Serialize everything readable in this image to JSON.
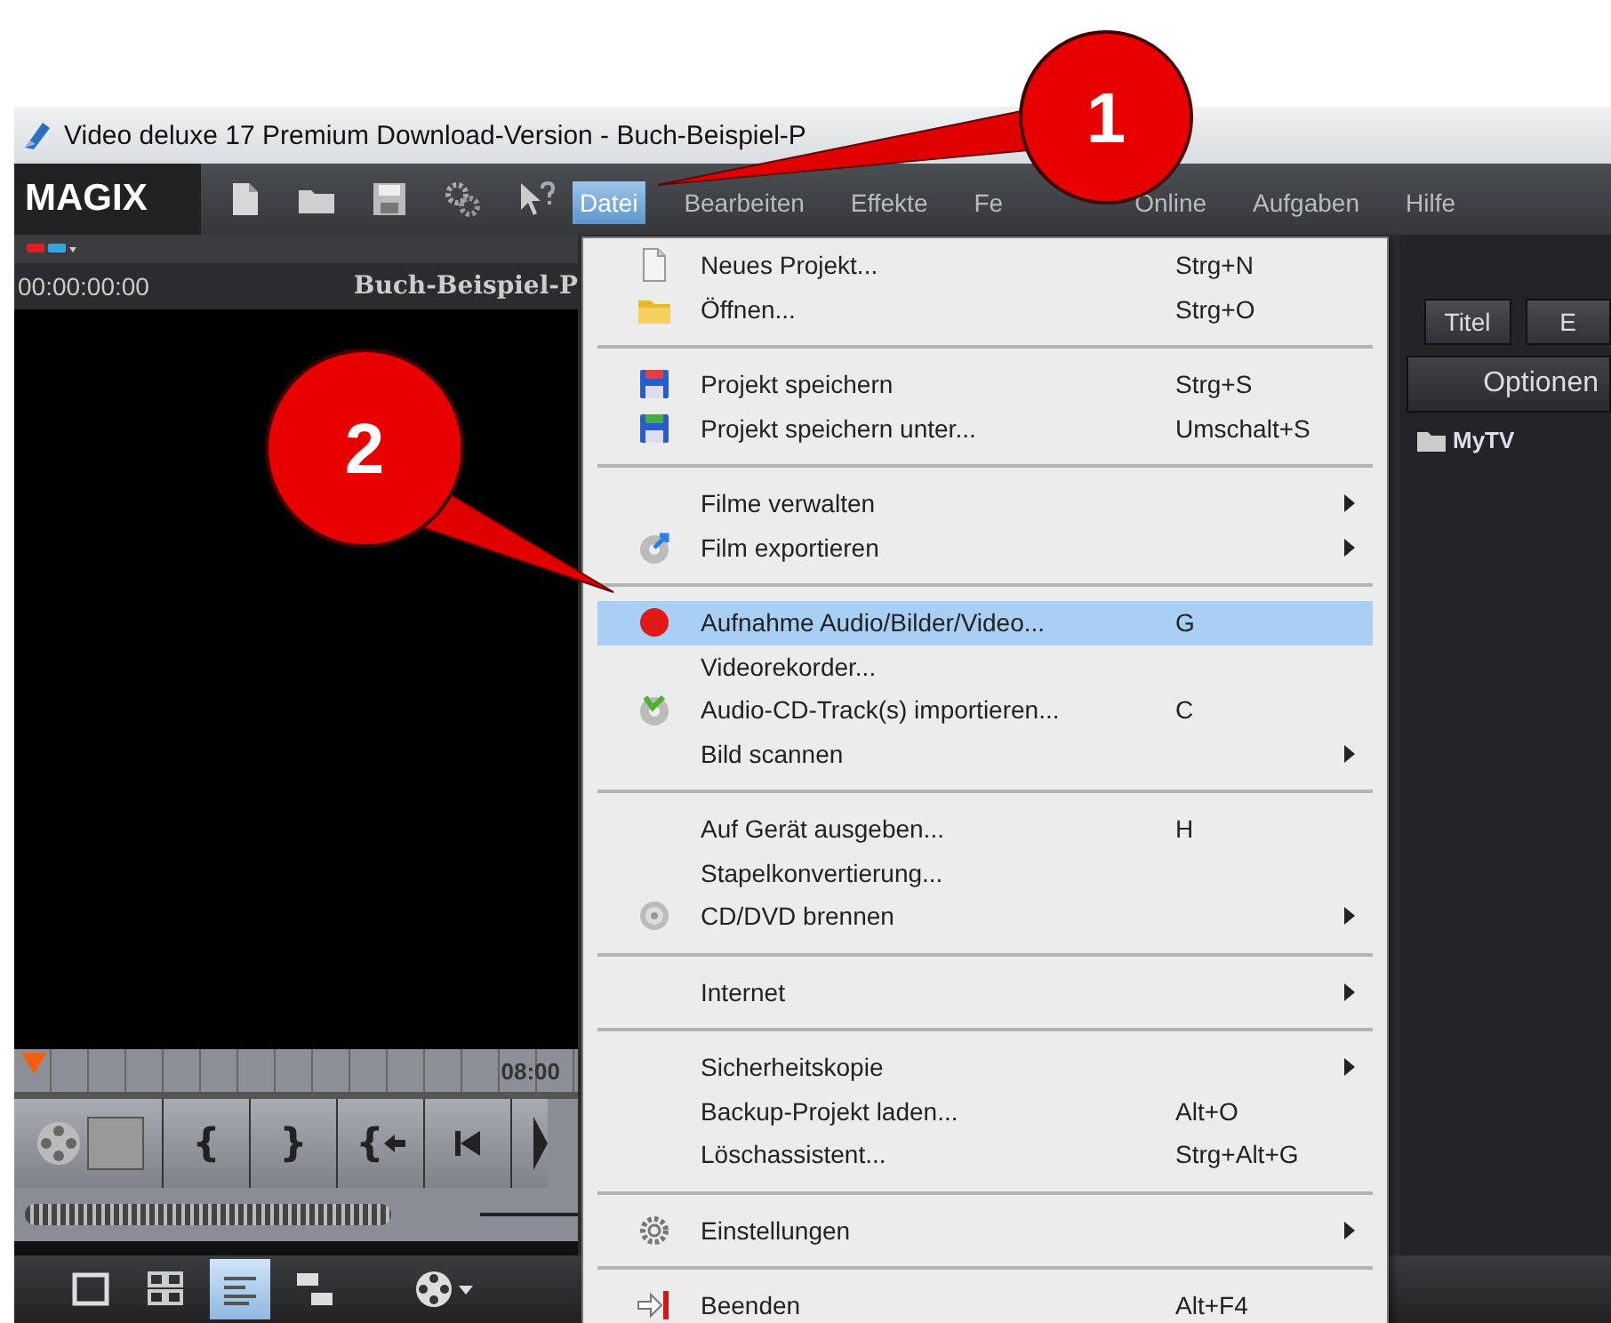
{
  "window": {
    "title": "Video deluxe 17 Premium Download-Version - Buch-Beispiel-P"
  },
  "logo": "MAGIX",
  "menubar": [
    {
      "label": "Datei",
      "selected": true
    },
    {
      "label": "Bearbeiten",
      "selected": false
    },
    {
      "label": "Effekte",
      "selected": false
    },
    {
      "label": "Fe",
      "selected": false
    },
    {
      "label": "Online",
      "selected": false
    },
    {
      "label": "Aufgaben",
      "selected": false
    },
    {
      "label": "Hilfe",
      "selected": false
    }
  ],
  "preview": {
    "timecode": "00:00:00:00",
    "project": "Buch-Beispiel-P",
    "ruler_time": "08:00"
  },
  "transport": [
    {
      "kind": "text",
      "label": "{"
    },
    {
      "kind": "text",
      "label": "}"
    },
    {
      "kind": "text-arrow",
      "label": "{"
    },
    {
      "kind": "skip-back"
    }
  ],
  "view_buttons": [
    {
      "selected": false
    },
    {
      "selected": false
    },
    {
      "selected": true
    },
    {
      "selected": false
    }
  ],
  "right_panel": {
    "tabs": [
      {
        "label": "Titel"
      },
      {
        "label": "E"
      }
    ],
    "options_button": "Optionen",
    "items": [
      {
        "label": "MyTV"
      }
    ]
  },
  "menu": {
    "groups": [
      [
        {
          "label": "Neues Projekt...",
          "shortcut": "Strg+N",
          "submenu": false,
          "kind": "page",
          "selected": false
        },
        {
          "label": "Öffnen...",
          "shortcut": "Strg+O",
          "submenu": false,
          "kind": "folder",
          "selected": false
        }
      ],
      [
        {
          "label": "Projekt speichern",
          "shortcut": "Strg+S",
          "submenu": false,
          "kind": "save",
          "selected": false
        },
        {
          "label": "Projekt speichern unter...",
          "shortcut": "Umschalt+S",
          "submenu": false,
          "kind": "save-as",
          "selected": false
        }
      ],
      [
        {
          "label": "Filme verwalten",
          "submenu": true,
          "selected": false
        },
        {
          "label": "Film exportieren",
          "submenu": true,
          "kind": "export",
          "selected": false
        }
      ],
      [
        {
          "label": "Aufnahme Audio/Bilder/Video...",
          "shortcut": "G",
          "submenu": false,
          "kind": "record",
          "selected": true
        },
        {
          "label": "Videorekorder...",
          "submenu": false,
          "selected": false
        },
        {
          "label": "Audio-CD-Track(s) importieren...",
          "shortcut": "C",
          "submenu": false,
          "kind": "cd-import",
          "selected": false
        },
        {
          "label": "Bild scannen",
          "submenu": true,
          "selected": false
        }
      ],
      [
        {
          "label": "Auf Gerät ausgeben...",
          "shortcut": "H",
          "submenu": false,
          "selected": false
        },
        {
          "label": "Stapelkonvertierung...",
          "submenu": false,
          "selected": false
        },
        {
          "label": "CD/DVD brennen",
          "submenu": true,
          "kind": "disc",
          "selected": false
        }
      ],
      [
        {
          "label": "Internet",
          "submenu": true,
          "selected": false
        }
      ],
      [
        {
          "label": "Sicherheitskopie",
          "submenu": true,
          "selected": false
        },
        {
          "label": "Backup-Projekt laden...",
          "shortcut": "Alt+O",
          "submenu": false,
          "selected": false
        },
        {
          "label": "Löschassistent...",
          "shortcut": "Strg+Alt+G",
          "submenu": false,
          "selected": false
        }
      ],
      [
        {
          "label": "Einstellungen",
          "submenu": true,
          "kind": "gear",
          "selected": false
        }
      ],
      [
        {
          "label": "Beenden",
          "shortcut": "Alt+F4",
          "submenu": false,
          "kind": "exit",
          "selected": false
        }
      ]
    ]
  },
  "callouts": [
    {
      "label": "1"
    },
    {
      "label": "2"
    }
  ]
}
